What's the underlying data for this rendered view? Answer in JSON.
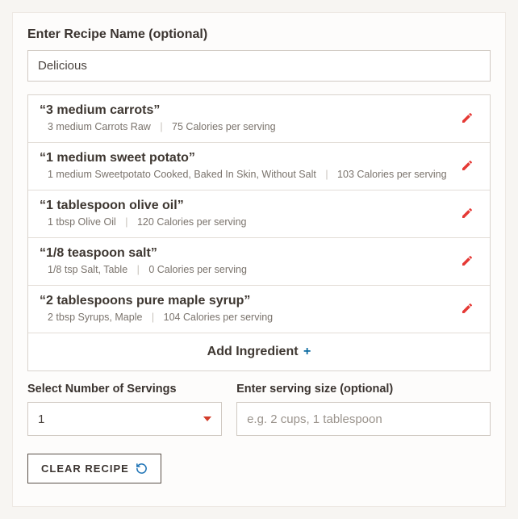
{
  "recipeName": {
    "label": "Enter Recipe Name (optional)",
    "value": "Delicious"
  },
  "ingredients": [
    {
      "title": "“3 medium carrots”",
      "detail": "3 medium Carrots Raw",
      "calories": "75 Calories per serving"
    },
    {
      "title": "“1 medium sweet potato”",
      "detail": "1 medium Sweetpotato Cooked, Baked In Skin, Without Salt",
      "calories": "103 Calories per serving"
    },
    {
      "title": "“1 tablespoon olive oil”",
      "detail": "1 tbsp Olive Oil",
      "calories": "120 Calories per serving"
    },
    {
      "title": "“1/8 teaspoon salt”",
      "detail": "1/8 tsp Salt, Table",
      "calories": "0 Calories per serving"
    },
    {
      "title": "“2 tablespoons pure maple syrup”",
      "detail": "2 tbsp Syrups, Maple",
      "calories": "104 Calories per serving"
    }
  ],
  "addIngredientLabel": "Add Ingredient",
  "servings": {
    "label": "Select Number of Servings",
    "value": "1"
  },
  "servingSize": {
    "label": "Enter serving size (optional)",
    "placeholder": "e.g. 2 cups, 1 tablespoon",
    "value": ""
  },
  "clearLabel": "CLEAR RECIPE"
}
